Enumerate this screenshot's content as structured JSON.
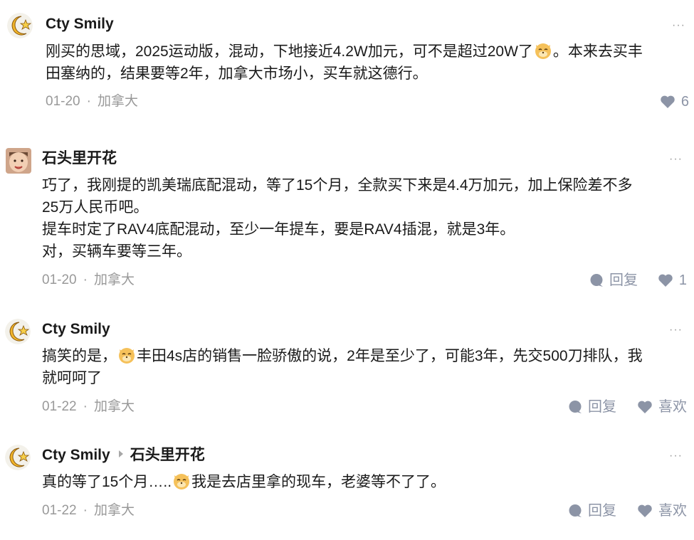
{
  "colors": {
    "icon": "#8c94a6",
    "meta": "#999999",
    "text": "#1a1a1a"
  },
  "comments": [
    {
      "author": "Cty Smily",
      "more": "···",
      "line1_a": "刚买的思域，2025运动版，混动，下地接近4.2W加元，可不是超过20W了",
      "line1_b": "。本来去买丰",
      "line2": "田塞纳的，结果要等2年，加拿大市场小，买车就这德行。",
      "date": "01-20",
      "sep": "·",
      "location": "加拿大",
      "likes": "6"
    },
    {
      "author": "石头里开花",
      "more": "···",
      "line1": "巧了，我刚提的凯美瑞底配混动，等了15个月，全款买下来是4.4万加元，加上保险差不多",
      "line2": "25万人民币吧。",
      "line3": "提车时定了RAV4底配混动，至少一年提车，要是RAV4插混，就是3年。",
      "line4": "对，买辆车要等三年。",
      "date": "01-20",
      "sep": "·",
      "location": "加拿大",
      "reply": "回复",
      "likes": "1"
    },
    {
      "author": "Cty Smily",
      "more": "···",
      "line1_a": "搞笑的是，",
      "line1_b": "丰田4s店的销售一脸骄傲的说，2年是至少了，可能3年，先交500刀排队，我",
      "line2": "就呵呵了",
      "date": "01-22",
      "sep": "·",
      "location": "加拿大",
      "reply": "回复",
      "like_label": "喜欢"
    },
    {
      "author": "Cty Smily",
      "reply_to": "石头里开花",
      "more": "···",
      "line1_a": "真的等了15个月…..",
      "line1_b": "我是去店里拿的现车，老婆等不了了。",
      "date": "01-22",
      "sep": "·",
      "location": "加拿大",
      "reply": "回复",
      "like_label": "喜欢"
    }
  ]
}
